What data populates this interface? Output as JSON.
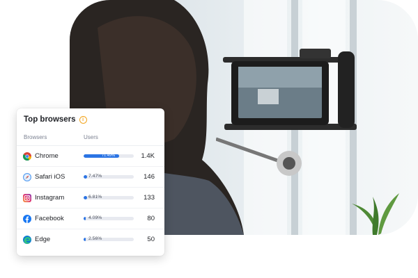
{
  "card": {
    "title": "Top browsers",
    "columns": {
      "browsers": "Browsers",
      "users": "Users"
    },
    "rows": [
      {
        "name": "Chrome",
        "icon": "chrome-icon",
        "percent_label": "71.49%",
        "share": 0.7149,
        "value": "1.4K"
      },
      {
        "name": "Safari iOS",
        "icon": "safari-icon",
        "percent_label": "7.47%",
        "share": 0.0747,
        "value": "146"
      },
      {
        "name": "Instagram",
        "icon": "instagram-icon",
        "percent_label": "6.81%",
        "share": 0.0681,
        "value": "133"
      },
      {
        "name": "Facebook",
        "icon": "facebook-icon",
        "percent_label": "4.09%",
        "share": 0.0409,
        "value": "80"
      },
      {
        "name": "Edge",
        "icon": "edge-icon",
        "percent_label": "2.56%",
        "share": 0.0256,
        "value": "50"
      }
    ]
  },
  "colors": {
    "bar_fill": "#2b74e4",
    "bar_track": "#e8eaf0",
    "info_accent": "#f2a51e"
  }
}
